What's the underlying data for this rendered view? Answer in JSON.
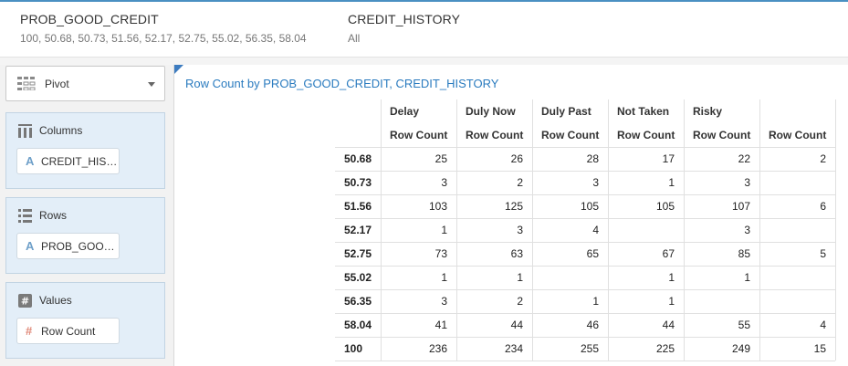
{
  "filters": [
    {
      "title": "PROB_GOOD_CREDIT",
      "values": "100, 50.68, 50.73, 51.56, 52.17, 52.75, 55.02, 56.35, 58.04"
    },
    {
      "title": "CREDIT_HISTORY",
      "values": "All"
    }
  ],
  "sidebar": {
    "view_type": "Pivot",
    "columns": {
      "title": "Columns",
      "chip_icon": "A",
      "chip": "CREDIT_HIS…"
    },
    "rows": {
      "title": "Rows",
      "chip_icon": "A",
      "chip": "PROB_GOO…"
    },
    "values": {
      "title": "Values",
      "chip_icon": "#",
      "chip": "Row Count"
    }
  },
  "main": {
    "title": "Row Count by PROB_GOOD_CREDIT, CREDIT_HISTORY"
  },
  "pivot": {
    "column_groups": [
      "Delay",
      "Duly Now",
      "Duly Past",
      "Not Taken",
      "Risky",
      ""
    ],
    "measure_label": "Row Count",
    "rows": [
      {
        "label": "50.68",
        "cells": [
          "25",
          "26",
          "28",
          "17",
          "22",
          "2"
        ]
      },
      {
        "label": "50.73",
        "cells": [
          "3",
          "2",
          "3",
          "1",
          "3",
          ""
        ]
      },
      {
        "label": "51.56",
        "cells": [
          "103",
          "125",
          "105",
          "105",
          "107",
          "6"
        ]
      },
      {
        "label": "52.17",
        "cells": [
          "1",
          "3",
          "4",
          "",
          "3",
          ""
        ]
      },
      {
        "label": "52.75",
        "cells": [
          "73",
          "63",
          "65",
          "67",
          "85",
          "5"
        ]
      },
      {
        "label": "55.02",
        "cells": [
          "1",
          "1",
          "",
          "1",
          "1",
          ""
        ]
      },
      {
        "label": "56.35",
        "cells": [
          "3",
          "2",
          "1",
          "1",
          "",
          ""
        ]
      },
      {
        "label": "58.04",
        "cells": [
          "41",
          "44",
          "46",
          "44",
          "55",
          "4"
        ]
      },
      {
        "label": "100",
        "cells": [
          "236",
          "234",
          "255",
          "225",
          "249",
          "15"
        ]
      }
    ]
  },
  "colors": {
    "accent": "#2a7bbf",
    "panel": "#e3eef8",
    "corner": "#3d7cc0"
  }
}
